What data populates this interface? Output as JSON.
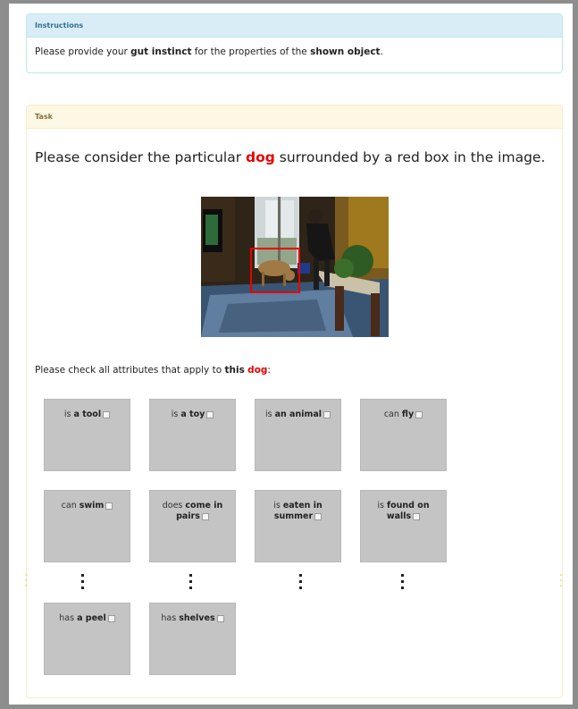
{
  "instructions": {
    "header": "Instructions",
    "text_pre": "Please provide your ",
    "text_bold1": "gut instinct",
    "text_mid": " for the properties of the ",
    "text_bold2": "shown object",
    "text_post": "."
  },
  "task": {
    "header": "Task",
    "title_pre": "Please consider the particular ",
    "title_object": "dog",
    "title_post": " surrounded by a red box in the image.",
    "check_pre": "Please check all attributes that apply to ",
    "check_bold": "this",
    "check_object": "dog",
    "check_post": ":"
  },
  "attributes": [
    {
      "pre": "is ",
      "bold": "a tool"
    },
    {
      "pre": "is ",
      "bold": "a toy"
    },
    {
      "pre": "is ",
      "bold": "an animal"
    },
    {
      "pre": "can ",
      "bold": "fly"
    },
    {
      "pre": "can ",
      "bold": "swim"
    },
    {
      "pre": "does ",
      "bold": "come in pairs"
    },
    {
      "pre": "is ",
      "bold": "eaten in summer"
    },
    {
      "pre": "is ",
      "bold": "found on walls"
    },
    {
      "pre": "has ",
      "bold": "a peel"
    },
    {
      "pre": "has ",
      "bold": "shelves"
    }
  ],
  "colors": {
    "highlight": "#e80000",
    "tile": "#c4c4c4",
    "info_header": "#d9edf7",
    "task_header": "#fcf8e3"
  }
}
